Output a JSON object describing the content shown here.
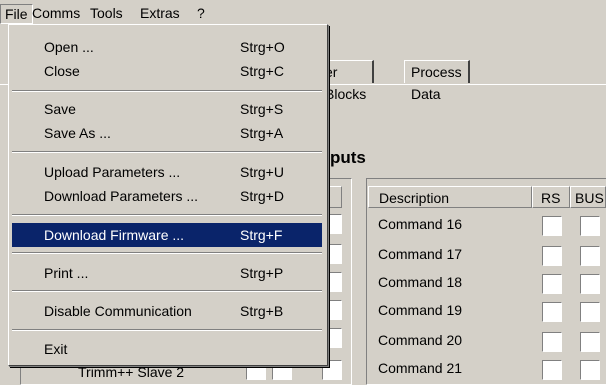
{
  "menubar": {
    "file": "File",
    "comms": "Comms",
    "tools": "Tools",
    "extras": "Extras",
    "help": "?"
  },
  "file_menu": {
    "open": {
      "label": "Open ...",
      "shortcut": "Strg+O"
    },
    "close": {
      "label": "Close",
      "shortcut": "Strg+C"
    },
    "save": {
      "label": "Save",
      "shortcut": "Strg+S"
    },
    "save_as": {
      "label": "Save As ...",
      "shortcut": "Strg+A"
    },
    "upload": {
      "label": "Upload Parameters ...",
      "shortcut": "Strg+U"
    },
    "download_params": {
      "label": "Download Parameters ...",
      "shortcut": "Strg+D"
    },
    "download_fw": {
      "label": "Download Firmware ...",
      "shortcut": "Strg+F"
    },
    "print": {
      "label": "Print ...",
      "shortcut": "Strg+P"
    },
    "disable_comm": {
      "label": "Disable Communication",
      "shortcut": "Strg+B"
    },
    "exit": {
      "label": "Exit"
    }
  },
  "tabs": {
    "blocks": "er Blocks",
    "process": "Process Data"
  },
  "section": {
    "title": "puts"
  },
  "left_table": {
    "header_bus": "US",
    "last_row_label": "Trimm++ Slave 2"
  },
  "right_table": {
    "headers": {
      "description": "Description",
      "rs": "RS",
      "bus": "BUS"
    },
    "rows": [
      "Command 16",
      "Command 17",
      "Command 18",
      "Command 19",
      "Command 20",
      "Command 21"
    ]
  },
  "colors": {
    "face": "#d4d0c8",
    "highlight": "#0a246a"
  }
}
